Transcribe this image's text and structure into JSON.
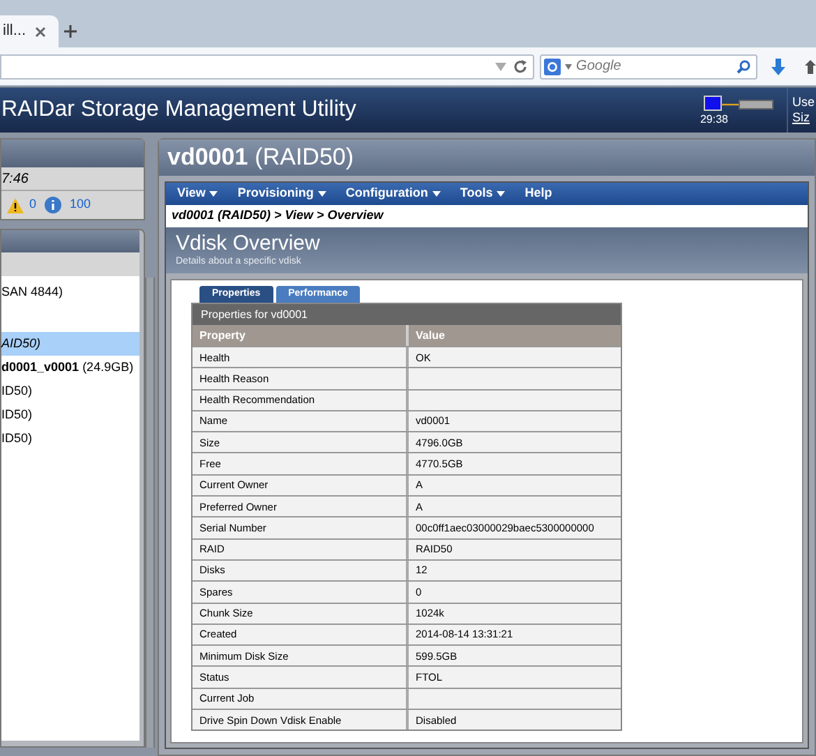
{
  "browser": {
    "tab_title": "ill...",
    "search_placeholder": "Google"
  },
  "app_header": {
    "title": "RAIDar Storage Management Utility",
    "time": "29:38",
    "user_label": "Use",
    "user_link": "Siz"
  },
  "status_panel": {
    "time": "7:46",
    "warning_count": "0",
    "info_count": "100"
  },
  "tree": {
    "items": [
      {
        "label": "SAN 4844)",
        "selected": false,
        "italic": false
      },
      {
        "label": "AID50)",
        "selected": true,
        "italic": true
      },
      {
        "label": "**d0001_v0001** (24.9GB)",
        "selected": false,
        "italic": false
      },
      {
        "label": "ID50)",
        "selected": false,
        "italic": false
      },
      {
        "label": "ID50)",
        "selected": false,
        "italic": false
      },
      {
        "label": "ID50)",
        "selected": false,
        "italic": false
      }
    ]
  },
  "main": {
    "title": "vd0001",
    "title_suffix": "(RAID50)",
    "menu": [
      {
        "label": "View",
        "dropdown": true
      },
      {
        "label": "Provisioning",
        "dropdown": true
      },
      {
        "label": "Configuration",
        "dropdown": true
      },
      {
        "label": "Tools",
        "dropdown": true
      },
      {
        "label": "Help",
        "dropdown": false
      }
    ],
    "breadcrumb": "vd0001 (RAID50) > View > Overview",
    "section_title": "Vdisk Overview",
    "section_subtitle": "Details about a specific vdisk",
    "tabs": [
      {
        "label": "Properties",
        "selected": true
      },
      {
        "label": "Performance",
        "selected": false
      }
    ],
    "table": {
      "caption": "Properties for vd0001",
      "columns": [
        "Property",
        "Value"
      ],
      "rows": [
        [
          "Health",
          "OK"
        ],
        [
          "Health Reason",
          ""
        ],
        [
          "Health Recommendation",
          ""
        ],
        [
          "Name",
          "vd0001"
        ],
        [
          "Size",
          "4796.0GB"
        ],
        [
          "Free",
          "4770.5GB"
        ],
        [
          "Current Owner",
          "A"
        ],
        [
          "Preferred Owner",
          "A"
        ],
        [
          "Serial Number",
          "00c0ff1aec03000029baec5300000000"
        ],
        [
          "RAID",
          "RAID50"
        ],
        [
          "Disks",
          "12"
        ],
        [
          "Spares",
          "0"
        ],
        [
          "Chunk Size",
          "1024k"
        ],
        [
          "Created",
          "2014-08-14 13:31:21"
        ],
        [
          "Minimum Disk Size",
          "599.5GB"
        ],
        [
          "Status",
          "FTOL"
        ],
        [
          "Current Job",
          ""
        ],
        [
          "Drive Spin Down Vdisk Enable",
          "Disabled"
        ]
      ]
    }
  }
}
